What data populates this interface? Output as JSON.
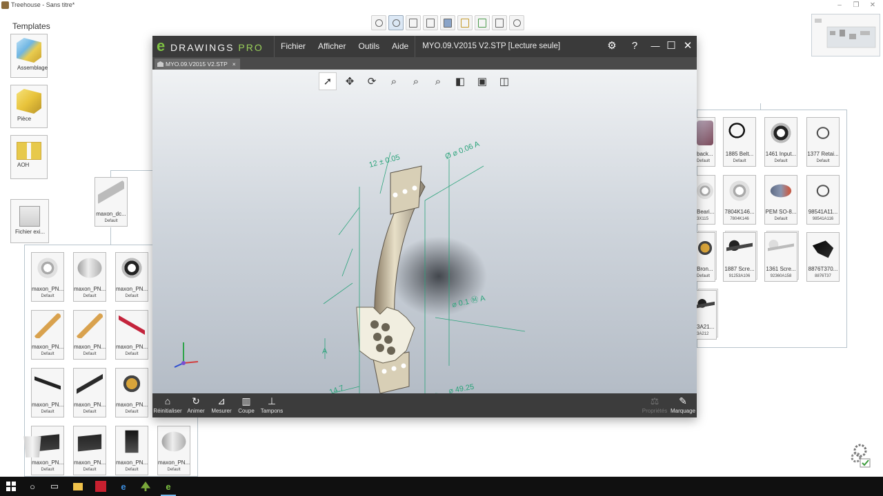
{
  "treehouse": {
    "title": "Treehouse - Sans titre*",
    "window_controls": [
      "–",
      "❐",
      "✕"
    ],
    "toolbar_icons": [
      "zoom-fit-icon",
      "zoom-area-icon",
      "new-document-icon",
      "open-folder-icon",
      "save-icon",
      "tree-icon",
      "refresh-icon",
      "print-icon",
      "help-icon"
    ]
  },
  "templates": {
    "title": "Templates",
    "items": [
      {
        "label": "Assemblage",
        "icon": "assembly-icon"
      },
      {
        "label": "Pièce",
        "icon": "part-icon"
      },
      {
        "label": "AOH",
        "icon": "aoh-icon"
      },
      {
        "label": "Fichier exi...",
        "icon": "existing-file-icon"
      }
    ]
  },
  "tree": {
    "root": {
      "label": "maxon_dc...",
      "config": "Default"
    },
    "left_items": [
      {
        "label": "maxon_PN...",
        "config": "Default"
      },
      {
        "label": "maxon_PN...",
        "config": "Default"
      },
      {
        "label": "maxon_PN...",
        "config": "Default"
      },
      {
        "label": "maxon_PN...",
        "config": "Default"
      },
      {
        "label": "maxon_PN...",
        "config": "Default"
      },
      {
        "label": "maxon_PN...",
        "config": "Default"
      },
      {
        "label": "maxon_PN...",
        "config": "Default"
      },
      {
        "label": "maxon_PN...",
        "config": "Default"
      },
      {
        "label": "maxon_PN...",
        "config": "Default"
      },
      {
        "label": "maxon_PN...",
        "config": "Default"
      },
      {
        "label": "maxon_PN...",
        "config": "Default"
      },
      {
        "label": "maxon_PN...",
        "config": "Default"
      },
      {
        "label": "maxon_PN...",
        "config": "Default"
      }
    ],
    "right_items": [
      {
        "label": "back...",
        "config": "Default"
      },
      {
        "label": "1885 Belt...",
        "config": "Default"
      },
      {
        "label": "1461 Input...",
        "config": "Default"
      },
      {
        "label": "1377 Retai...",
        "config": "Default"
      },
      {
        "label": "Beari...",
        "config": "3X115"
      },
      {
        "label": "7804K146...",
        "config": "7804K146"
      },
      {
        "label": "PEM SO-8...",
        "config": "Default"
      },
      {
        "label": "98541A11...",
        "config": "98541A116"
      },
      {
        "label": "Bron...",
        "config": "Default"
      },
      {
        "label": "1887 Scre...",
        "config": "91253A106"
      },
      {
        "label": "1361 Scre...",
        "config": "92360A158"
      },
      {
        "label": "8876T370...",
        "config": "8876T37"
      },
      {
        "label": "3A21...",
        "config": "3A212"
      }
    ]
  },
  "edrawings": {
    "logo_mark": "e",
    "logo_word": "DRAWINGS",
    "logo_pro": "PRO",
    "menu": [
      "Fichier",
      "Afficher",
      "Outils",
      "Aide"
    ],
    "document_title": "MYO.09.V2015 V2.STP [Lecture seule]",
    "tab_label": "MYO.09.V2015 V2.STP",
    "tab_close": "×",
    "window_buttons": {
      "settings": "⚙",
      "help": "?",
      "minimize": "—",
      "maximize": "☐",
      "close": "✕"
    },
    "view_tools": [
      "select-icon",
      "pan-icon",
      "rotate-icon",
      "zoom-icon",
      "zoom-area-icon",
      "zoom-fit-icon",
      "view-orientation-icon",
      "display-style-icon",
      "section-view-icon"
    ],
    "annotations": {
      "dim1": "Ø ⌀ 0.06 A",
      "dim2": "12 ± 0.05",
      "dim3": "⌀ 0.1 Ⓜ A",
      "dim4": "⌀ 49.25",
      "dim5": "14.7",
      "datum": "A"
    },
    "bottom_tools": [
      {
        "label": "Réinitialiser",
        "icon": "home-icon",
        "enabled": true
      },
      {
        "label": "Animer",
        "icon": "animate-icon",
        "enabled": true
      },
      {
        "label": "Mesurer",
        "icon": "measure-icon",
        "enabled": true
      },
      {
        "label": "Coupe",
        "icon": "section-icon",
        "enabled": true
      },
      {
        "label": "Tampons",
        "icon": "stamp-icon",
        "enabled": true
      },
      {
        "label": "Propriétés",
        "icon": "properties-icon",
        "enabled": false
      },
      {
        "label": "Marquage",
        "icon": "markup-icon",
        "enabled": true
      }
    ],
    "accent_green": "#7ec242",
    "annotation_color": "#2aa37a"
  },
  "taskbar": {
    "icons": [
      "windows-start-icon",
      "search-icon",
      "task-view-icon",
      "file-explorer-icon",
      "solidworks-icon",
      "edge-icon",
      "treehouse-icon",
      "edrawings-icon"
    ]
  }
}
